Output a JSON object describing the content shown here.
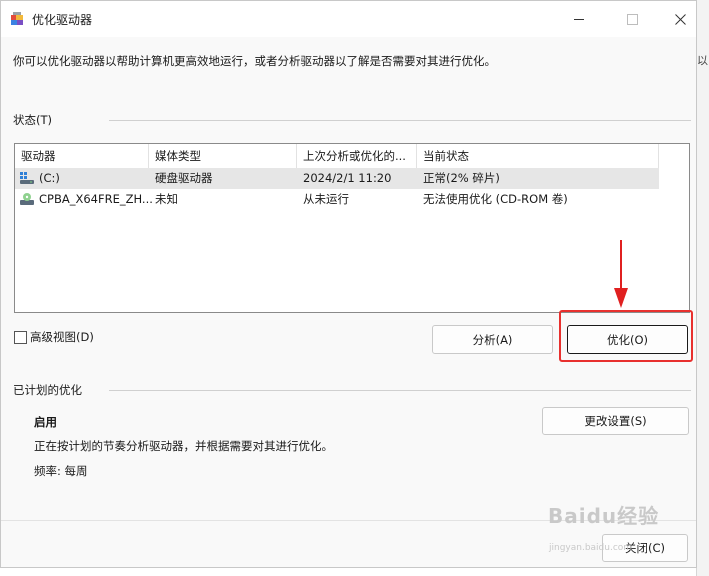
{
  "window": {
    "title": "优化驱动器",
    "description": "你可以优化驱动器以帮助计算机更高效地运行，或者分析驱动器以了解是否需要对其进行优化。"
  },
  "status_section": {
    "label": "状态(T)",
    "columns": [
      "驱动器",
      "媒体类型",
      "上次分析或优化的...",
      "当前状态"
    ],
    "rows": [
      {
        "drive": "(C:)",
        "media_type": "硬盘驱动器",
        "last_run": "2024/2/1 11:20",
        "status": "正常(2% 碎片)",
        "icon": "hard-drive-icon",
        "selected": true
      },
      {
        "drive": "CPBA_X64FRE_ZH...",
        "media_type": "未知",
        "last_run": "从未运行",
        "status": "无法使用优化 (CD-ROM 卷)",
        "icon": "cd-drive-icon",
        "selected": false
      }
    ],
    "advanced_view_label": "高级视图(D)",
    "advanced_view_checked": false,
    "analyze_label": "分析(A)",
    "optimize_label": "优化(O)"
  },
  "scheduled_section": {
    "label": "已计划的优化",
    "state": "启用",
    "description": "正在按计划的节奏分析驱动器，并根据需要对其进行优化。",
    "frequency": "频率: 每周",
    "change_settings_label": "更改设置(S)"
  },
  "footer": {
    "close_label": "关闭(C)"
  },
  "annotation": {
    "color": "#e8302e"
  },
  "background": {
    "partial_text": "以"
  },
  "watermark": {
    "text": "Baidu经验",
    "sub": "jingyan.baidu.com"
  }
}
